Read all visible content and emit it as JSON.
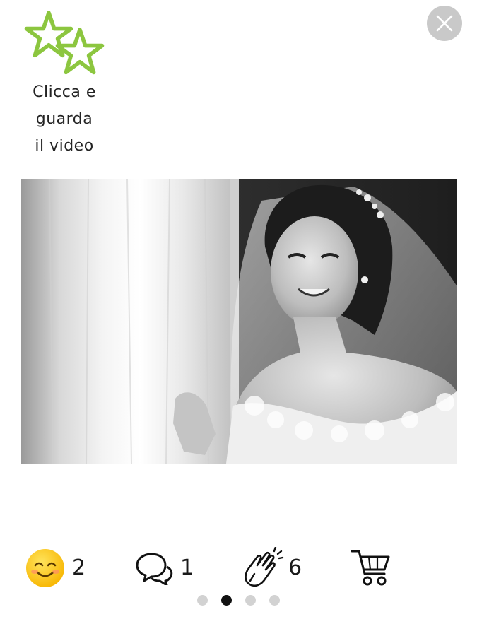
{
  "video_cta": {
    "line1": "Clicca e",
    "line2": "guarda",
    "line3": "il video",
    "star_color": "#8cc63f",
    "icon": "star-icon"
  },
  "close": {
    "icon": "close-icon"
  },
  "photo": {
    "style": "black and white"
  },
  "reactions": {
    "smile": {
      "icon": "smiling-face-icon",
      "count": "2"
    },
    "comments": {
      "icon": "speech-bubbles-icon",
      "count": "1"
    },
    "claps": {
      "icon": "clapping-hands-icon",
      "count": "6"
    },
    "cart": {
      "icon": "shopping-cart-icon"
    }
  },
  "pagination": {
    "total": 4,
    "active_index": 1
  }
}
